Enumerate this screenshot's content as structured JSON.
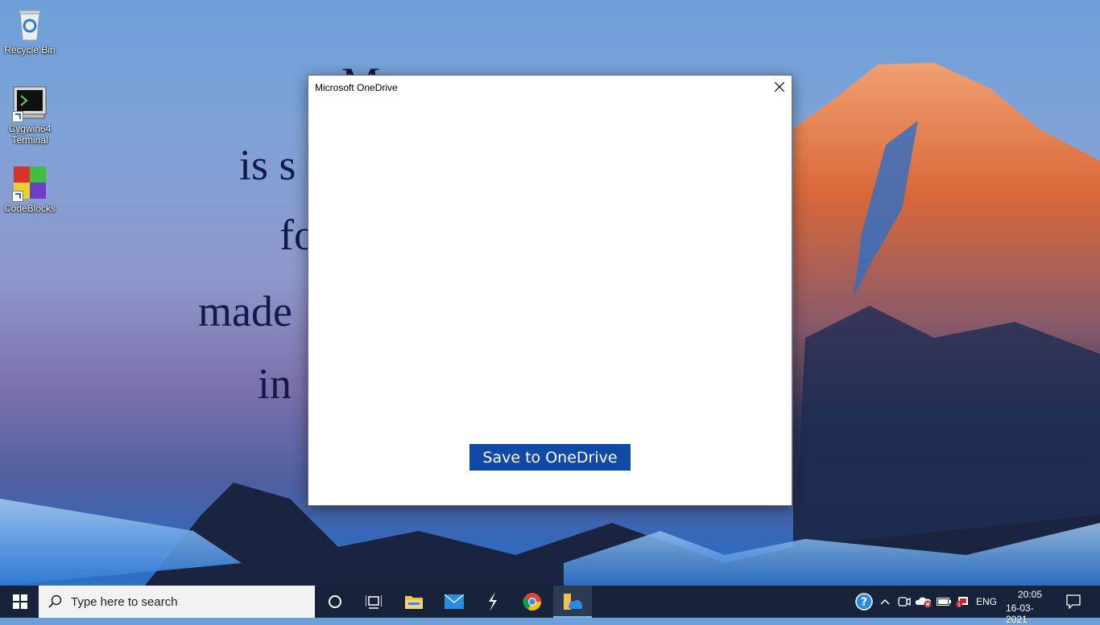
{
  "desktop": {
    "icons": [
      {
        "label": "Recycle Bin",
        "icon": "recycle-bin-icon"
      },
      {
        "label": "Cygwin64\nTerminal",
        "icon": "terminal-icon"
      },
      {
        "label": "CodeBlocks",
        "icon": "codeblocks-icon"
      }
    ],
    "wallpaper_quote": [
      "M",
      "is s",
      "fo",
      "made",
      "in"
    ]
  },
  "dialog": {
    "title": "Microsoft OneDrive",
    "save_label": "Save to OneDrive",
    "close_icon": "close-icon",
    "accent_color": "#0f4aa6"
  },
  "taskbar": {
    "search_placeholder": "Type here to search",
    "apps": [
      "task-view-icon",
      "file-explorer-icon",
      "mail-icon",
      "app-s-icon",
      "chrome-icon",
      "onedrive-explorer-icon"
    ],
    "language": "ENG",
    "time": "20:05",
    "date": "16-03-2021"
  }
}
